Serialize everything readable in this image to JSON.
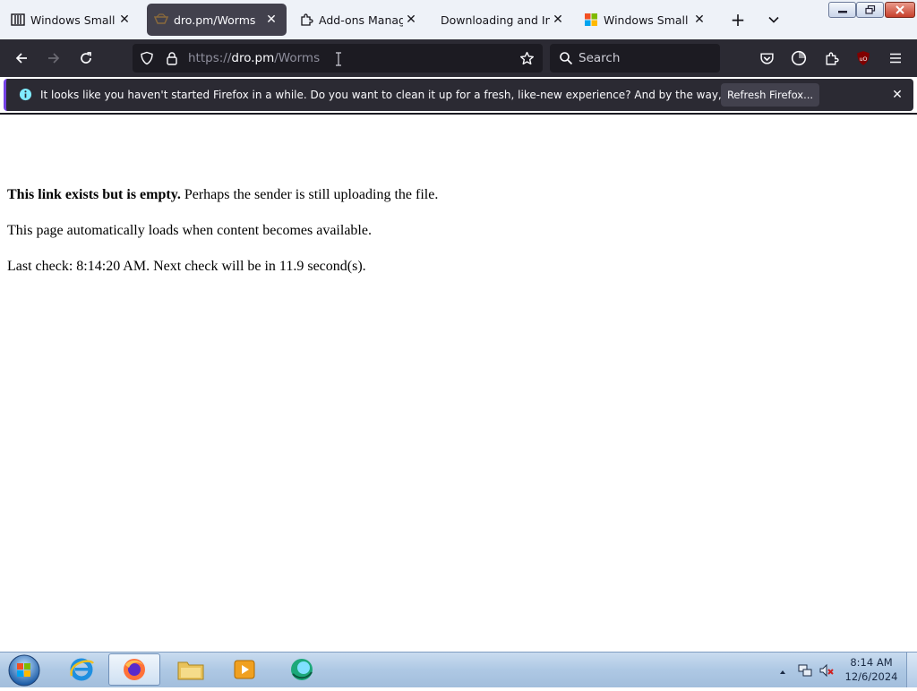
{
  "tabs": [
    {
      "label": "Windows Small Bus",
      "icon": "columns-icon",
      "active": false
    },
    {
      "label": "dro.pm/Worms",
      "icon": "droppm-icon",
      "active": true
    },
    {
      "label": "Add-ons Manager",
      "icon": "puzzle-icon",
      "active": false
    },
    {
      "label": "Downloading and Insta",
      "icon": "",
      "active": false
    },
    {
      "label": "Windows Small Bus",
      "icon": "windows-logo-icon",
      "active": false
    }
  ],
  "toolbar": {
    "url_prefix": "https://",
    "url_host": "dro.pm",
    "url_path": "/Worms",
    "search_placeholder": "Search"
  },
  "notification": {
    "message": "It looks like you haven't started Firefox in a while. Do you want to clean it up for a fresh, like-new experience? And by the way, welcome back!",
    "button_label": "Refresh Firefox..."
  },
  "page": {
    "line1_bold": "This link exists but is empty.",
    "line1_rest": " Perhaps the sender is still uploading the file.",
    "line2": "This page automatically loads when content becomes available.",
    "line3": "Last check: 8:14:20 AM. Next check will be in 11.9 second(s)."
  },
  "taskbar": {
    "time": "8:14 AM",
    "date": "12/6/2024"
  },
  "colors": {
    "accent": "#7542e5",
    "toolbar_bg": "#2b2a33",
    "tabstrip_bg": "#eef2f8",
    "ublock": "#800000"
  }
}
